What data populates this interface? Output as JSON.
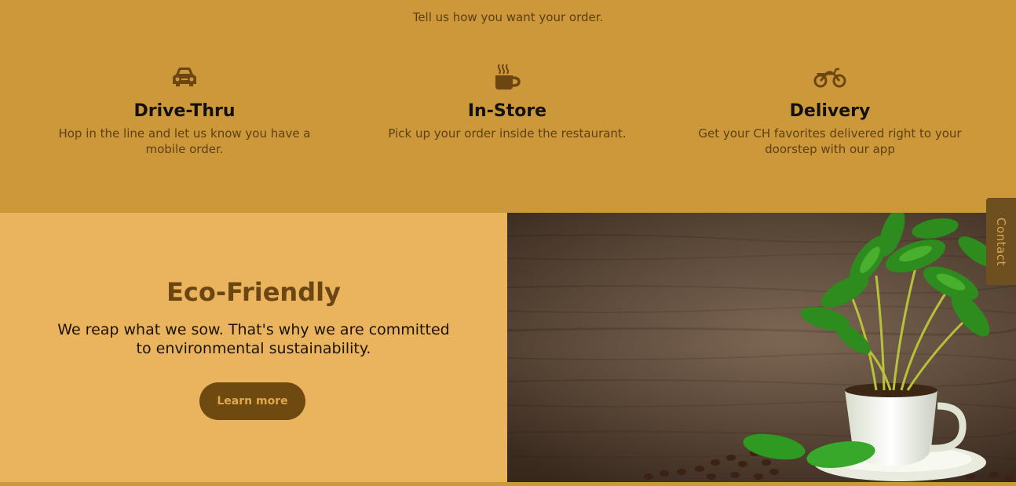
{
  "order": {
    "intro": "Tell us how you want your order.",
    "options": [
      {
        "icon": "car-icon",
        "title": "Drive-Thru",
        "description": "Hop in the line and let us know you have a mobile order."
      },
      {
        "icon": "coffee-cup-icon",
        "title": "In-Store",
        "description": "Pick up your order inside the restaurant."
      },
      {
        "icon": "motorcycle-icon",
        "title": "Delivery",
        "description": "Get your CH favorites delivered right to your doorstep with our app"
      }
    ]
  },
  "eco": {
    "title": "Eco-Friendly",
    "text": "We reap what we sow. That's why we are committed to environmental sustainability.",
    "button_label": "Learn more",
    "image": "coffee-plant-in-cup-photo"
  },
  "contact_tab": {
    "label": "Contact"
  },
  "colors": {
    "order_bg": "#cc9839",
    "eco_bg": "#e9b45d",
    "accent_dark": "#6e4910",
    "icon_color": "#6b4613"
  }
}
